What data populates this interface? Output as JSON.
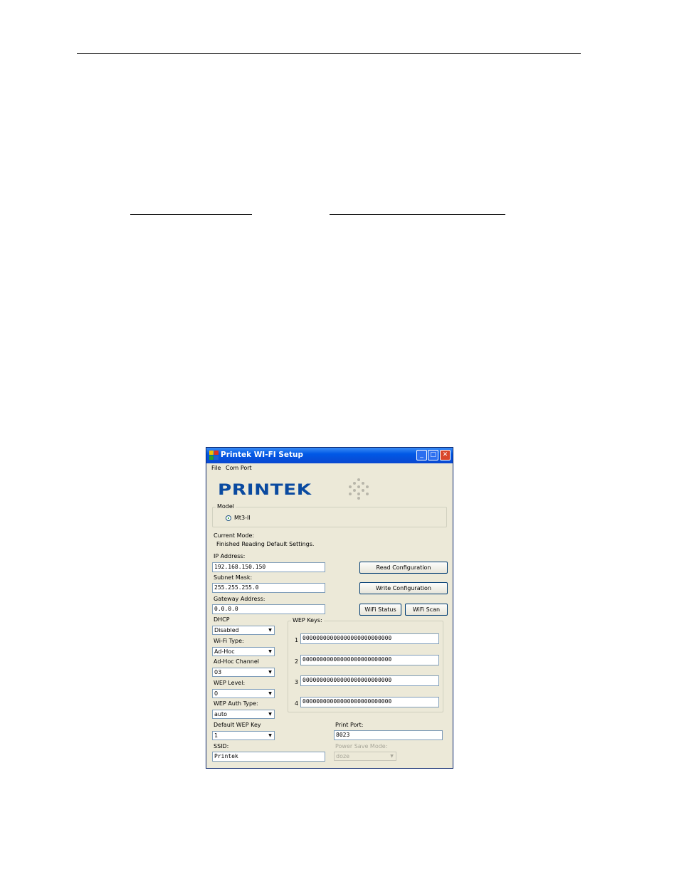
{
  "window": {
    "title": "Printek WI-FI Setup"
  },
  "menu": {
    "items": [
      "File",
      "Com Port"
    ]
  },
  "logo": {
    "text": "PRINTEK"
  },
  "model_group": {
    "title": "Model",
    "option": "Mt3-II"
  },
  "status": {
    "label": "Current Mode:",
    "value": "Finished Reading Default Settings."
  },
  "network": {
    "ip_label": "IP Address:",
    "ip_value": "192.168.150.150",
    "subnet_label": "Subnet Mask:",
    "subnet_value": "255.255.255.0",
    "gateway_label": "Gateway Address:",
    "gateway_value": "0.0.0.0"
  },
  "buttons": {
    "read": "Read Configuration",
    "write": "Write Configuration",
    "wifi_status": "WiFi Status",
    "wifi_scan": "WiFi Scan"
  },
  "settings": {
    "dhcp_label": "DHCP",
    "dhcp_value": "Disabled",
    "wifi_type_label": "Wi-Fi Type:",
    "wifi_type_value": "Ad-Hoc",
    "adhoc_channel_label": "Ad-Hoc Channel",
    "adhoc_channel_value": "03",
    "wep_level_label": "WEP Level:",
    "wep_level_value": "0",
    "wep_auth_label": "WEP Auth Type:",
    "wep_auth_value": "auto",
    "default_wep_label": "Default WEP Key",
    "default_wep_value": "1",
    "ssid_label": "SSID:",
    "ssid_value": "Printek"
  },
  "wep_keys": {
    "title": "WEP Keys:",
    "keys": [
      {
        "num": "1",
        "value": "00000000000000000000000000"
      },
      {
        "num": "2",
        "value": "00000000000000000000000000"
      },
      {
        "num": "3",
        "value": "00000000000000000000000000"
      },
      {
        "num": "4",
        "value": "00000000000000000000000000"
      }
    ]
  },
  "print_port": {
    "label": "Print Port:",
    "value": "8023"
  },
  "power_save": {
    "label": "Power Save Mode:",
    "value": "doze"
  }
}
